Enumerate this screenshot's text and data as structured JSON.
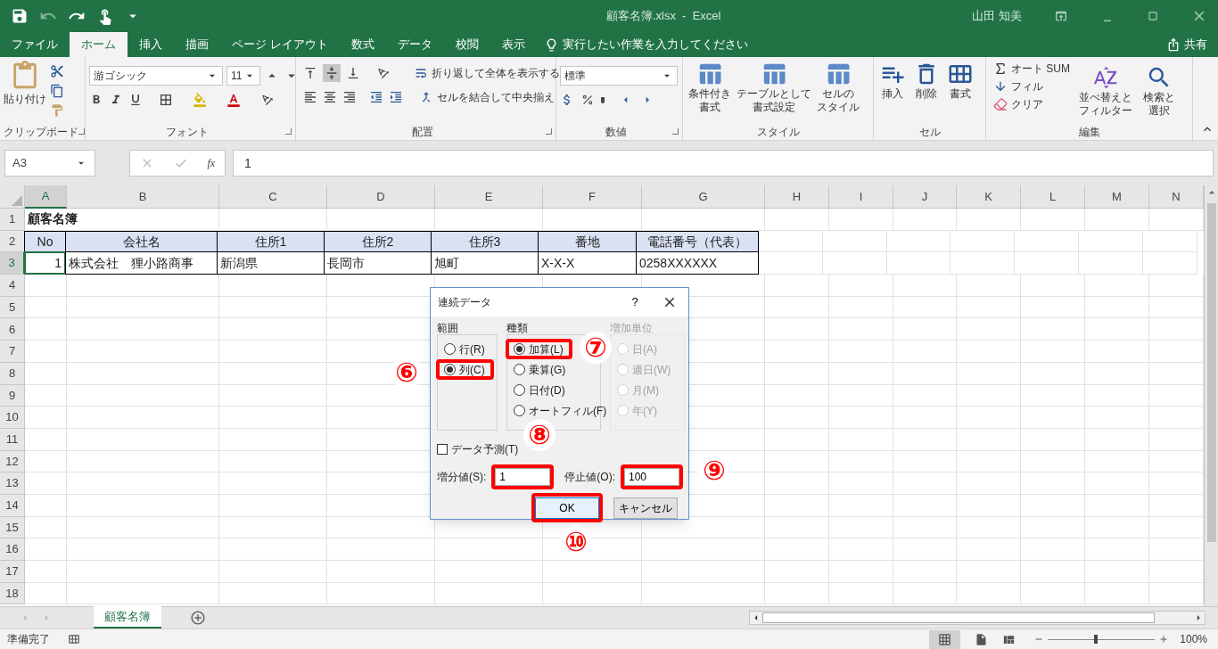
{
  "title_bar": {
    "title": "顧客名簿.xlsx  -  Excel",
    "user": "山田 知美"
  },
  "ribbon_tabs": [
    {
      "label": "ファイル",
      "selected": false
    },
    {
      "label": "ホーム",
      "selected": true
    },
    {
      "label": "挿入",
      "selected": false
    },
    {
      "label": "描画",
      "selected": false
    },
    {
      "label": "ページ レイアウト",
      "selected": false
    },
    {
      "label": "数式",
      "selected": false
    },
    {
      "label": "データ",
      "selected": false
    },
    {
      "label": "校閲",
      "selected": false
    },
    {
      "label": "表示",
      "selected": false
    }
  ],
  "tell_me": "実行したい作業を入力してください",
  "share": "共有",
  "ribbon": {
    "clipboard": {
      "paste": "貼り付け",
      "label": "クリップボード"
    },
    "font": {
      "font_name": "游ゴシック",
      "font_size": "11",
      "label": "フォント"
    },
    "alignment": {
      "wrap_text": "折り返して全体を表示する",
      "merge": "セルを結合して中央揃え",
      "label": "配置"
    },
    "number": {
      "format": "標準",
      "label": "数値"
    },
    "styles": {
      "buttons": [
        [
          "条件付き",
          "書式"
        ],
        [
          "テーブルとして",
          "書式設定"
        ],
        [
          "セルの",
          "スタイル"
        ]
      ],
      "label": "スタイル"
    },
    "cells": {
      "buttons": [
        "挿入",
        "削除",
        "書式"
      ],
      "label": "セル"
    },
    "editing": {
      "autosum": "オート SUM",
      "fill": "フィル",
      "clear": "クリア",
      "sort": [
        "並べ替えと",
        "フィルター"
      ],
      "find": [
        "検索と",
        "選択"
      ],
      "label": "編集"
    }
  },
  "formula_bar": {
    "name_box": "A3",
    "function_label": "fx",
    "value": "1"
  },
  "columns": [
    {
      "label": "A",
      "selected": true
    },
    {
      "label": "B",
      "selected": false
    },
    {
      "label": "C",
      "selected": false
    },
    {
      "label": "D",
      "selected": false
    },
    {
      "label": "E",
      "selected": false
    },
    {
      "label": "F",
      "selected": false
    },
    {
      "label": "G",
      "selected": false
    },
    {
      "label": "H",
      "selected": false
    },
    {
      "label": "I",
      "selected": false
    },
    {
      "label": "J",
      "selected": false
    },
    {
      "label": "K",
      "selected": false
    },
    {
      "label": "L",
      "selected": false
    },
    {
      "label": "M",
      "selected": false
    },
    {
      "label": "N",
      "selected": false
    }
  ],
  "rows": [
    {
      "number": "1",
      "selected": false,
      "kind": "title",
      "cells": [
        {
          "text": "顧客名簿",
          "selected": false
        }
      ]
    },
    {
      "number": "2",
      "selected": false,
      "kind": "header",
      "cells": [
        {
          "text": "No",
          "selected": false
        },
        {
          "text": "会社名",
          "selected": false
        },
        {
          "text": "住所1",
          "selected": false
        },
        {
          "text": "住所2",
          "selected": false
        },
        {
          "text": "住所3",
          "selected": false
        },
        {
          "text": "番地",
          "selected": false
        },
        {
          "text": "電話番号（代表）",
          "selected": false
        }
      ]
    },
    {
      "number": "3",
      "selected": true,
      "kind": "data",
      "cells": [
        {
          "text": "1",
          "selected": true
        },
        {
          "text": "株式会社　狸小路商事",
          "selected": false
        },
        {
          "text": "新潟県",
          "selected": false
        },
        {
          "text": "長岡市",
          "selected": false
        },
        {
          "text": "旭町",
          "selected": false
        },
        {
          "text": "X-X-X",
          "selected": false
        },
        {
          "text": "0258XXXXXX",
          "selected": false
        }
      ]
    },
    {
      "number": "4",
      "selected": false,
      "kind": "empty"
    },
    {
      "number": "5",
      "selected": false,
      "kind": "empty"
    },
    {
      "number": "6",
      "selected": false,
      "kind": "empty"
    },
    {
      "number": "7",
      "selected": false,
      "kind": "empty"
    },
    {
      "number": "8",
      "selected": false,
      "kind": "empty"
    },
    {
      "number": "9",
      "selected": false,
      "kind": "empty"
    },
    {
      "number": "10",
      "selected": false,
      "kind": "empty"
    },
    {
      "number": "11",
      "selected": false,
      "kind": "empty"
    },
    {
      "number": "12",
      "selected": false,
      "kind": "empty"
    },
    {
      "number": "13",
      "selected": false,
      "kind": "empty"
    },
    {
      "number": "14",
      "selected": false,
      "kind": "empty"
    },
    {
      "number": "15",
      "selected": false,
      "kind": "empty"
    },
    {
      "number": "16",
      "selected": false,
      "kind": "empty"
    },
    {
      "number": "17",
      "selected": false,
      "kind": "empty"
    },
    {
      "number": "18",
      "selected": false,
      "kind": "empty"
    }
  ],
  "dialog": {
    "title": "連続データ",
    "help": "?",
    "groups": [
      {
        "label": "範囲",
        "disabled": false,
        "options": [
          {
            "label": "行(R)",
            "selected": false,
            "highlighted": false
          },
          {
            "label": "列(C)",
            "selected": true,
            "highlighted": true
          }
        ]
      },
      {
        "label": "種類",
        "disabled": false,
        "options": [
          {
            "label": "加算(L)",
            "selected": true,
            "highlighted": true
          },
          {
            "label": "乗算(G)",
            "selected": false,
            "highlighted": false
          },
          {
            "label": "日付(D)",
            "selected": false,
            "highlighted": false
          },
          {
            "label": "オートフィル(F)",
            "selected": false,
            "highlighted": false
          }
        ]
      },
      {
        "label": "増加単位",
        "disabled": true,
        "options": [
          {
            "label": "日(A)",
            "selected": false,
            "highlighted": false
          },
          {
            "label": "週日(W)",
            "selected": false,
            "highlighted": false
          },
          {
            "label": "月(M)",
            "selected": false,
            "highlighted": false
          },
          {
            "label": "年(Y)",
            "selected": false,
            "highlighted": false
          }
        ]
      }
    ],
    "trend": {
      "label": "データ予測(T)",
      "checked": false
    },
    "step": {
      "label": "増分値(S):",
      "value": "1",
      "highlighted": true
    },
    "stop": {
      "label": "停止値(O):",
      "value": "100",
      "highlighted": true
    },
    "buttons": [
      {
        "label": "OK",
        "highlighted": true
      },
      {
        "label": "キャンセル",
        "highlighted": false
      }
    ]
  },
  "callouts": [
    "⑥",
    "⑦",
    "⑧",
    "⑨",
    "⑩"
  ],
  "sheet_tabs": [
    {
      "label": "顧客名簿",
      "selected": true
    }
  ],
  "status_bar": {
    "status": "準備完了",
    "zoom": "100%",
    "level": 0.45
  }
}
